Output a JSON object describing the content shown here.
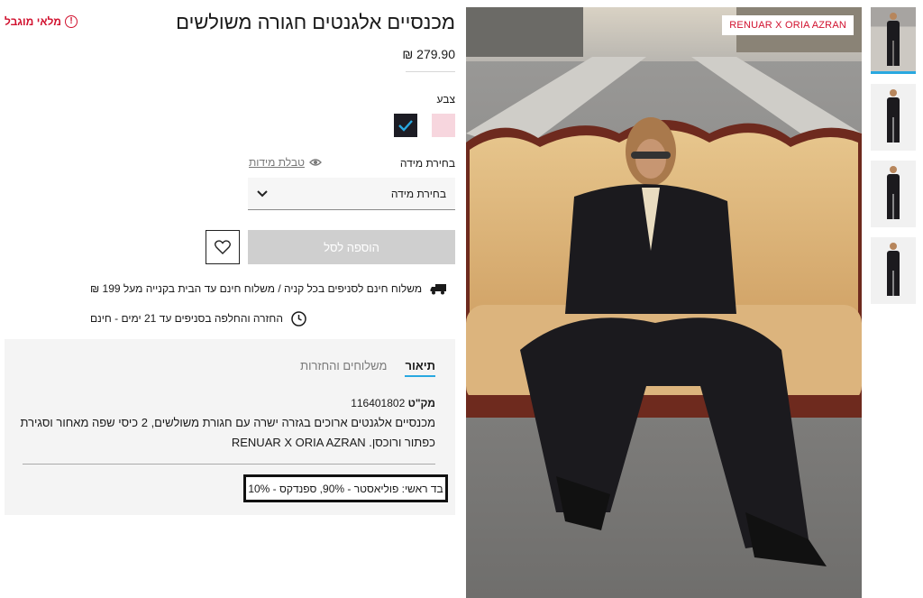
{
  "product": {
    "title": "מכנסיים אלגנטים חגורה משולשים",
    "price": "279.90 ₪",
    "sold_out": "מלאי מוגבל",
    "brand_tag": "RENUAR X ORIA AZRAN"
  },
  "color": {
    "label": "צבע",
    "swatches": [
      {
        "name": "black",
        "hex": "#1c1c24",
        "selected": true
      },
      {
        "name": "pink",
        "hex": "#f7d6de",
        "selected": false
      }
    ]
  },
  "size": {
    "label": "בחירת מידה",
    "table_link": "טבלת מידות",
    "select_value": "בחירת מידה"
  },
  "actions": {
    "add_to_cart": "הוספה לסל"
  },
  "shipping": {
    "line1": "משלוח חינם לסניפים בכל קניה / משלוח חינם עד הבית בקנייה מעל 199 ₪",
    "line2": "החזרה והחלפה בסניפים עד 21 ימים - חינם"
  },
  "details": {
    "tabs": [
      "תיאור",
      "משלוחים והחזרות"
    ],
    "sku_label": "מק\"ט",
    "sku": "116401802",
    "description": "מכנסיים אלגנטים ארוכים בגזרה ישרה עם חגורת משולשים, 2 כיסי שפה מאחור וסגירת כפתור ורוכסן. RENUAR X ORIA AZRAN",
    "fabric": "בד ראשי: פוליאסטר - 90%, ספנדקס - 10%"
  },
  "colors": {
    "accent": "#29a8e0",
    "alert": "#d1112e"
  }
}
